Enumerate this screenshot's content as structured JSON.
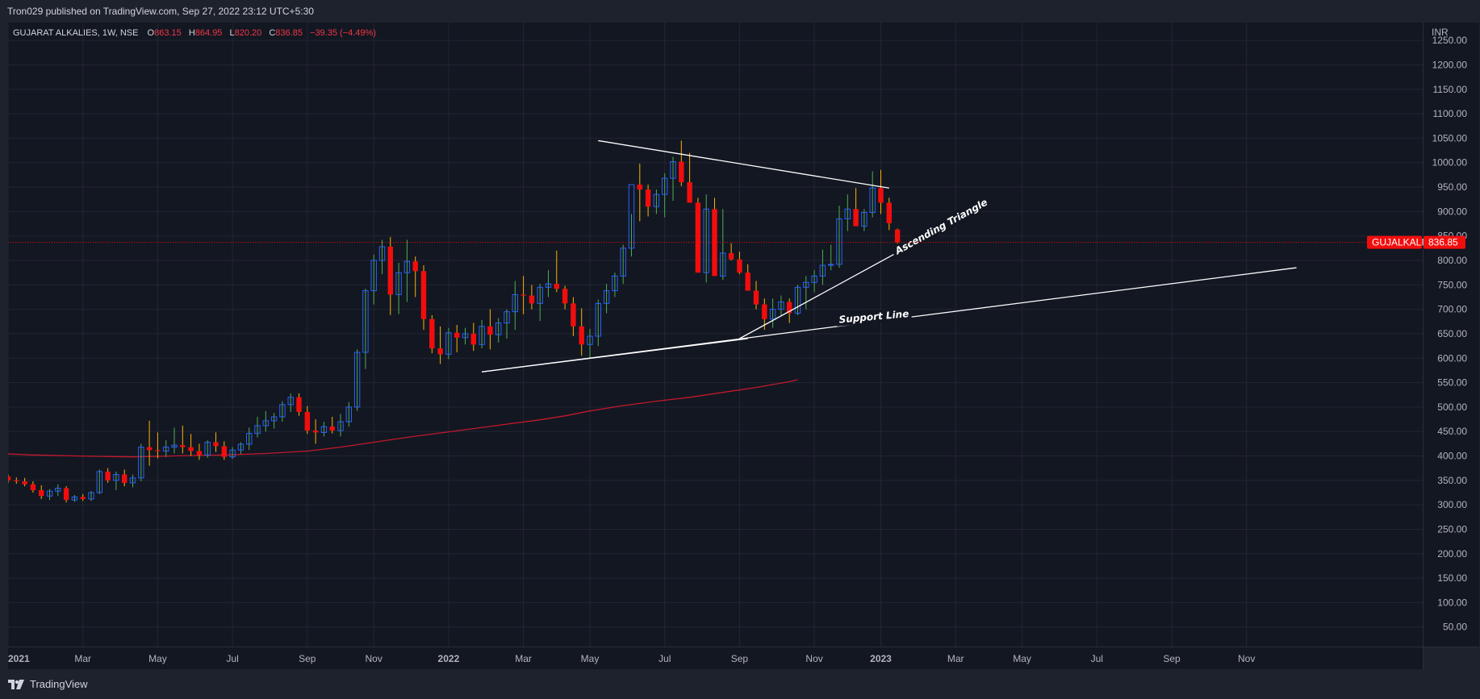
{
  "header": {
    "published": "Tron029 published on TradingView.com, Sep 27, 2022 23:12 UTC+5:30"
  },
  "footer": {
    "brand": "TradingView"
  },
  "colors": {
    "background": "#131722",
    "frame": "#1e222d",
    "grid": "#232632",
    "up": "#2962ff",
    "down": "#f20d0d",
    "wick_up": "#4caf50",
    "wick_down": "#ffb300",
    "ma": "#c2182b",
    "trendline": "#ffffff",
    "price_tag": "#f20d0d"
  },
  "chart_data": {
    "type": "candlestick",
    "legend": {
      "symbol": "GUJARAT ALKALIES, 1W, NSE",
      "open_label": "O",
      "open": "863.15",
      "high_label": "H",
      "high": "864.95",
      "low_label": "L",
      "low": "820.20",
      "close_label": "C",
      "close": "836.85",
      "change": "−39.35 (−4.49%)"
    },
    "currency": "INR",
    "ylim": [
      10,
      1270
    ],
    "y_ticks": [
      "50.00",
      "100.00",
      "150.00",
      "200.00",
      "250.00",
      "300.00",
      "350.00",
      "400.00",
      "450.00",
      "500.00",
      "550.00",
      "600.00",
      "650.00",
      "700.00",
      "750.00",
      "800.00",
      "850.00",
      "900.00",
      "950.00",
      "1000.00",
      "1050.00",
      "1100.00",
      "1150.00",
      "1200.00",
      "1250.00"
    ],
    "x_ticks": [
      {
        "label": "2021",
        "week": 0,
        "bold": true
      },
      {
        "label": "Mar",
        "week": 9
      },
      {
        "label": "May",
        "week": 18
      },
      {
        "label": "Jul",
        "week": 27
      },
      {
        "label": "Sep",
        "week": 36
      },
      {
        "label": "Nov",
        "week": 44
      },
      {
        "label": "2022",
        "week": 53,
        "bold": true
      },
      {
        "label": "Mar",
        "week": 62
      },
      {
        "label": "May",
        "week": 70
      },
      {
        "label": "Jul",
        "week": 79
      },
      {
        "label": "Sep",
        "week": 88
      },
      {
        "label": "Nov",
        "week": 97
      },
      {
        "label": "2023",
        "week": 105,
        "bold": true
      },
      {
        "label": "Mar",
        "week": 114
      },
      {
        "label": "May",
        "week": 122
      },
      {
        "label": "Jul",
        "week": 131
      },
      {
        "label": "Sep",
        "week": 140
      },
      {
        "label": "Nov",
        "week": 149
      }
    ],
    "candles": [
      [
        358,
        362,
        345,
        350
      ],
      [
        350,
        356,
        343,
        348
      ],
      [
        348,
        355,
        338,
        342
      ],
      [
        342,
        348,
        325,
        330
      ],
      [
        330,
        340,
        312,
        318
      ],
      [
        318,
        332,
        310,
        328
      ],
      [
        328,
        342,
        318,
        334
      ],
      [
        334,
        338,
        305,
        310
      ],
      [
        310,
        320,
        306,
        316
      ],
      [
        316,
        322,
        308,
        312
      ],
      [
        312,
        328,
        308,
        325
      ],
      [
        325,
        372,
        322,
        368
      ],
      [
        368,
        375,
        345,
        350
      ],
      [
        350,
        368,
        330,
        362
      ],
      [
        362,
        372,
        338,
        345
      ],
      [
        345,
        362,
        336,
        355
      ],
      [
        355,
        425,
        348,
        418
      ],
      [
        418,
        472,
        380,
        412
      ],
      [
        412,
        448,
        395,
        410
      ],
      [
        410,
        432,
        398,
        418
      ],
      [
        418,
        458,
        405,
        422
      ],
      [
        422,
        462,
        405,
        418
      ],
      [
        418,
        445,
        400,
        410
      ],
      [
        410,
        425,
        392,
        402
      ],
      [
        402,
        432,
        396,
        428
      ],
      [
        428,
        448,
        408,
        420
      ],
      [
        420,
        430,
        392,
        398
      ],
      [
        398,
        418,
        394,
        412
      ],
      [
        412,
        428,
        404,
        424
      ],
      [
        424,
        458,
        412,
        446
      ],
      [
        446,
        480,
        438,
        462
      ],
      [
        462,
        492,
        450,
        472
      ],
      [
        472,
        488,
        456,
        480
      ],
      [
        480,
        512,
        470,
        505
      ],
      [
        505,
        528,
        490,
        520
      ],
      [
        520,
        528,
        482,
        490
      ],
      [
        490,
        502,
        445,
        452
      ],
      [
        452,
        475,
        425,
        448
      ],
      [
        448,
        470,
        440,
        460
      ],
      [
        460,
        480,
        446,
        452
      ],
      [
        452,
        486,
        440,
        470
      ],
      [
        470,
        510,
        460,
        500
      ],
      [
        500,
        618,
        492,
        612
      ],
      [
        612,
        742,
        578,
        738
      ],
      [
        738,
        812,
        710,
        800
      ],
      [
        800,
        842,
        772,
        828
      ],
      [
        828,
        848,
        688,
        730
      ],
      [
        730,
        795,
        690,
        775
      ],
      [
        775,
        842,
        715,
        798
      ],
      [
        798,
        808,
        725,
        778
      ],
      [
        778,
        790,
        658,
        680
      ],
      [
        680,
        688,
        610,
        620
      ],
      [
        620,
        665,
        588,
        608
      ],
      [
        608,
        662,
        598,
        652
      ],
      [
        652,
        668,
        612,
        642
      ],
      [
        642,
        662,
        628,
        650
      ],
      [
        650,
        672,
        615,
        628
      ],
      [
        628,
        678,
        620,
        665
      ],
      [
        665,
        700,
        618,
        648
      ],
      [
        648,
        682,
        632,
        672
      ],
      [
        672,
        700,
        640,
        695
      ],
      [
        695,
        758,
        658,
        730
      ],
      [
        730,
        768,
        690,
        728
      ],
      [
        728,
        750,
        700,
        712
      ],
      [
        712,
        752,
        676,
        745
      ],
      [
        745,
        780,
        725,
        752
      ],
      [
        752,
        820,
        735,
        742
      ],
      [
        742,
        748,
        700,
        712
      ],
      [
        712,
        725,
        645,
        665
      ],
      [
        665,
        702,
        605,
        628
      ],
      [
        628,
        660,
        600,
        645
      ],
      [
        645,
        720,
        625,
        712
      ],
      [
        712,
        752,
        692,
        738
      ],
      [
        738,
        775,
        725,
        768
      ],
      [
        768,
        832,
        752,
        825
      ],
      [
        825,
        895,
        808,
        955
      ],
      [
        955,
        998,
        880,
        945
      ],
      [
        945,
        955,
        890,
        910
      ],
      [
        910,
        945,
        895,
        935
      ],
      [
        935,
        978,
        888,
        968
      ],
      [
        968,
        1012,
        922,
        1002
      ],
      [
        1002,
        1045,
        952,
        960
      ],
      [
        960,
        1020,
        920,
        918
      ],
      [
        918,
        928,
        775,
        775
      ],
      [
        775,
        935,
        755,
        905
      ],
      [
        905,
        928,
        800,
        768
      ],
      [
        768,
        905,
        760,
        815
      ],
      [
        815,
        835,
        800,
        802
      ],
      [
        802,
        818,
        772,
        775
      ],
      [
        775,
        792,
        740,
        738
      ],
      [
        738,
        758,
        700,
        710
      ],
      [
        710,
        722,
        658,
        680
      ],
      [
        680,
        722,
        662,
        700
      ],
      [
        700,
        728,
        688,
        715
      ],
      [
        715,
        722,
        672,
        692
      ],
      [
        692,
        750,
        688,
        745
      ],
      [
        745,
        768,
        700,
        755
      ],
      [
        755,
        780,
        735,
        768
      ],
      [
        768,
        822,
        750,
        790
      ],
      [
        790,
        832,
        780,
        792
      ],
      [
        792,
        912,
        785,
        885
      ],
      [
        885,
        935,
        860,
        905
      ],
      [
        905,
        948,
        880,
        870
      ],
      [
        870,
        905,
        860,
        898
      ],
      [
        898,
        982,
        888,
        948
      ],
      [
        948,
        985,
        895,
        918
      ],
      [
        918,
        928,
        862,
        876
      ],
      [
        863,
        865,
        820,
        837
      ]
    ],
    "ma_points": [
      [
        -1,
        405
      ],
      [
        3,
        402
      ],
      [
        8,
        400
      ],
      [
        15,
        398
      ],
      [
        20,
        400
      ],
      [
        26,
        402
      ],
      [
        31,
        405
      ],
      [
        36,
        410
      ],
      [
        40,
        418
      ],
      [
        44,
        428
      ],
      [
        48,
        438
      ],
      [
        52,
        447
      ],
      [
        56,
        456
      ],
      [
        60,
        465
      ],
      [
        64,
        474
      ],
      [
        67,
        482
      ],
      [
        70,
        492
      ],
      [
        74,
        503
      ],
      [
        78,
        512
      ],
      [
        82,
        520
      ],
      [
        86,
        530
      ],
      [
        90,
        540
      ],
      [
        94,
        552
      ],
      [
        95,
        556
      ]
    ],
    "trendlines": [
      {
        "from": [
          71,
          1045
        ],
        "to": [
          106,
          948
        ]
      },
      {
        "from": [
          57,
          572
        ],
        "to": [
          89,
          640
        ]
      },
      {
        "from": [
          88,
          640
        ],
        "to": [
          109,
          835
        ]
      },
      {
        "from": [
          57,
          572
        ],
        "to": [
          155,
          785
        ]
      }
    ],
    "annotations": [
      {
        "text": "Ascending Triangle",
        "week": 107,
        "price": 812,
        "angle": -29
      },
      {
        "text": "Support Line",
        "week": 100,
        "price": 672,
        "angle": -5
      }
    ],
    "last_price_label": "GUJALKALI",
    "last_price_value": "836.85",
    "last_price": 836.85
  }
}
